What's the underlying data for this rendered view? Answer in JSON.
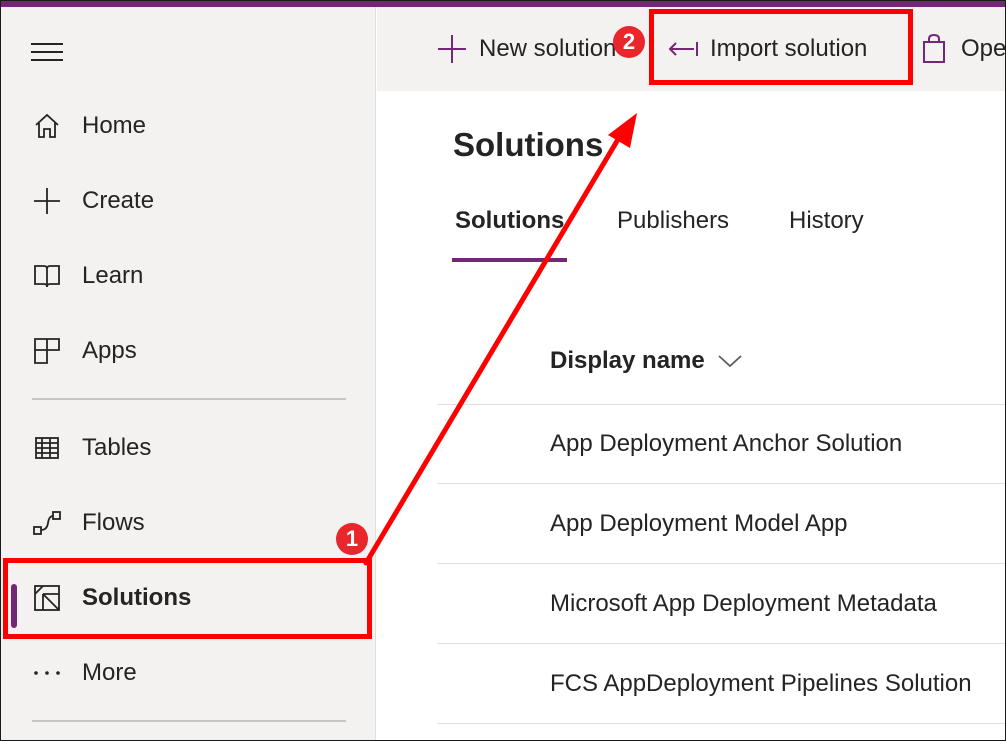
{
  "sidebar": {
    "items": [
      {
        "label": "Home",
        "icon": "home-icon"
      },
      {
        "label": "Create",
        "icon": "plus-icon"
      },
      {
        "label": "Learn",
        "icon": "book-icon"
      },
      {
        "label": "Apps",
        "icon": "apps-icon"
      },
      {
        "label": "Tables",
        "icon": "table-icon"
      },
      {
        "label": "Flows",
        "icon": "flow-icon"
      },
      {
        "label": "Solutions",
        "icon": "solutions-icon",
        "active": true
      },
      {
        "label": "More",
        "icon": "more-icon"
      }
    ]
  },
  "command_bar": {
    "new_solution": "New solution",
    "import_solution": "Import solution",
    "open_appsource": "Ope"
  },
  "main": {
    "title": "Solutions",
    "tabs": [
      {
        "label": "Solutions",
        "active": true
      },
      {
        "label": "Publishers"
      },
      {
        "label": "History"
      }
    ],
    "table": {
      "column_header": "Display name",
      "rows": [
        "App Deployment Anchor Solution",
        "App Deployment Model App",
        "Microsoft App Deployment Metadata",
        "FCS AppDeployment Pipelines Solution"
      ]
    }
  },
  "annotations": {
    "step1": "1",
    "step2": "2",
    "color": "#ff0000"
  },
  "colors": {
    "accent": "#742774",
    "sidebar_bg": "#f3f2f1"
  }
}
